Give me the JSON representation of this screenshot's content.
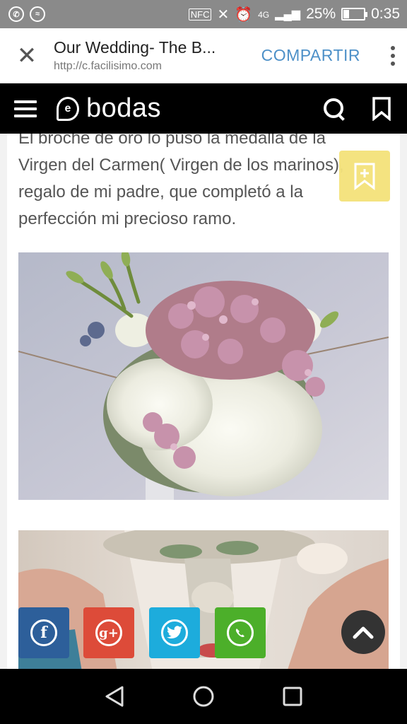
{
  "status_bar": {
    "network": "4G",
    "nfc": "NFC",
    "battery_percent": "25%",
    "battery_level": 0.25,
    "time": "0:35"
  },
  "tab": {
    "title": "Our Wedding- The B...",
    "url": "http://c.facilisimo.com",
    "share_label": "COMPARTIR"
  },
  "site": {
    "logo_text": "bodas",
    "logo_color": "#ffffff",
    "header_bg": "#000000"
  },
  "article": {
    "paragraph": [
      "El broche de oro lo puso la medalla de la",
      "Virgen del Carmen( Virgen de los marinos),",
      "regalo de mi padre, que completó a la",
      "perfección mi precioso ramo."
    ]
  },
  "share_buttons": [
    {
      "network": "facebook",
      "glyph": "f",
      "color": "#2d5f9a"
    },
    {
      "network": "google-plus",
      "glyph": "g+",
      "color": "#dd4b39"
    },
    {
      "network": "twitter",
      "glyph": "t",
      "color": "#1dacdc"
    },
    {
      "network": "whatsapp",
      "glyph": "w",
      "color": "#4caf2a"
    }
  ],
  "icons": {
    "close": "close-icon",
    "more": "more-vert-icon",
    "menu": "hamburger-icon",
    "search": "search-icon",
    "bookmark": "bookmark-icon",
    "save": "save-bookmark-icon",
    "scroll_top": "chevron-up-icon",
    "nav_back": "back-triangle-icon",
    "nav_home": "home-circle-icon",
    "nav_recent": "recent-square-icon"
  }
}
